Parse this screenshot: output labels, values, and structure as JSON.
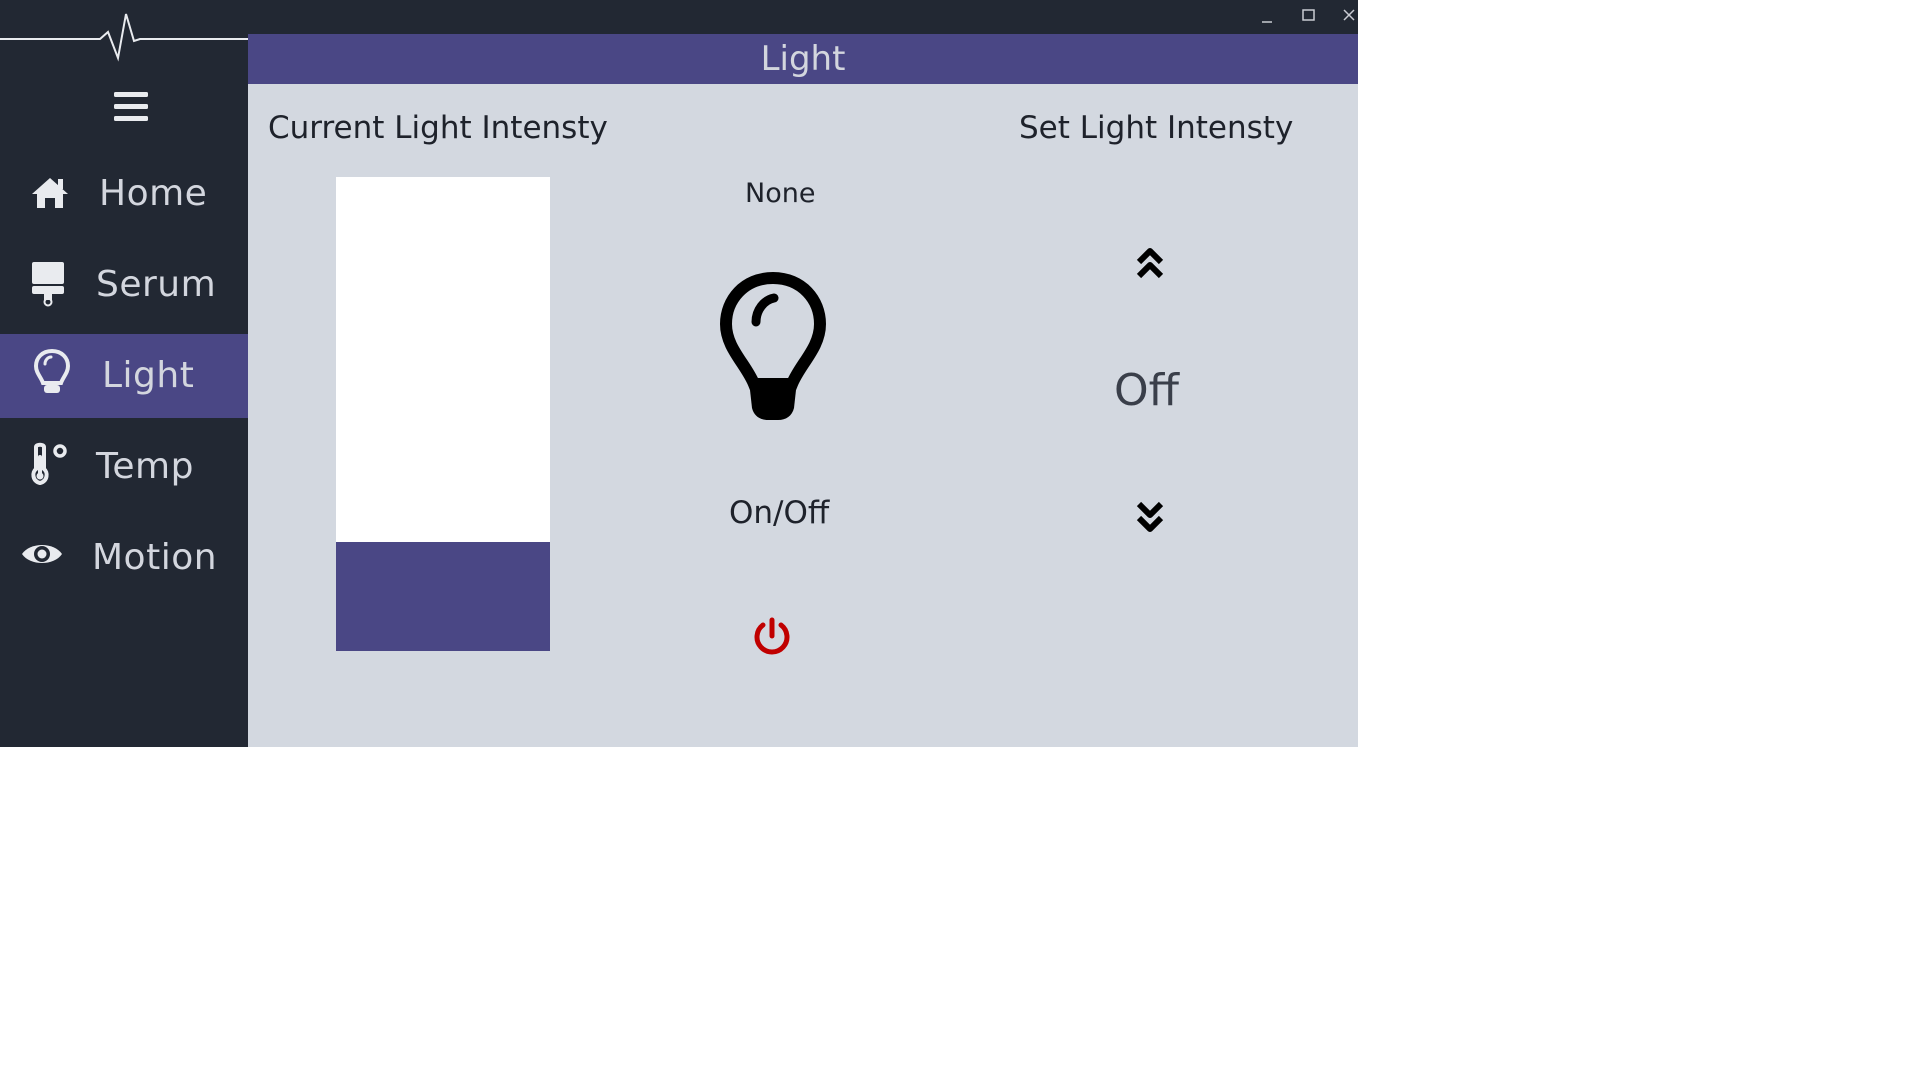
{
  "window": {
    "title": "Light",
    "controls": {
      "minimize": "minimize-icon",
      "maximize": "maximize-icon",
      "close": "close-icon"
    }
  },
  "sidebar": {
    "logo_icon": "heartbeat-pulse-icon",
    "menu_icon": "hamburger-menu-icon",
    "items": [
      {
        "label": "Home",
        "icon": "home-icon",
        "active": false
      },
      {
        "label": "Serum",
        "icon": "paint-brush-icon",
        "active": false
      },
      {
        "label": "Light",
        "icon": "lightbulb-icon",
        "active": true
      },
      {
        "label": "Temp",
        "icon": "thermometer-icon",
        "active": false
      },
      {
        "label": "Motion",
        "icon": "eye-icon",
        "active": false
      }
    ]
  },
  "main": {
    "current_intensity_label": "Current Light Intensty",
    "set_intensity_label": "Set Light Intensty",
    "status_text": "None",
    "onoff_label": "On/Off",
    "set_value": "Off",
    "intensity_fill_fraction": 0.23
  },
  "colors": {
    "sidebar_bg": "#222833",
    "accent": "#4a4785",
    "content_bg": "#d3d8e0",
    "power_red": "#c00000",
    "text_light": "#d3d6de"
  }
}
